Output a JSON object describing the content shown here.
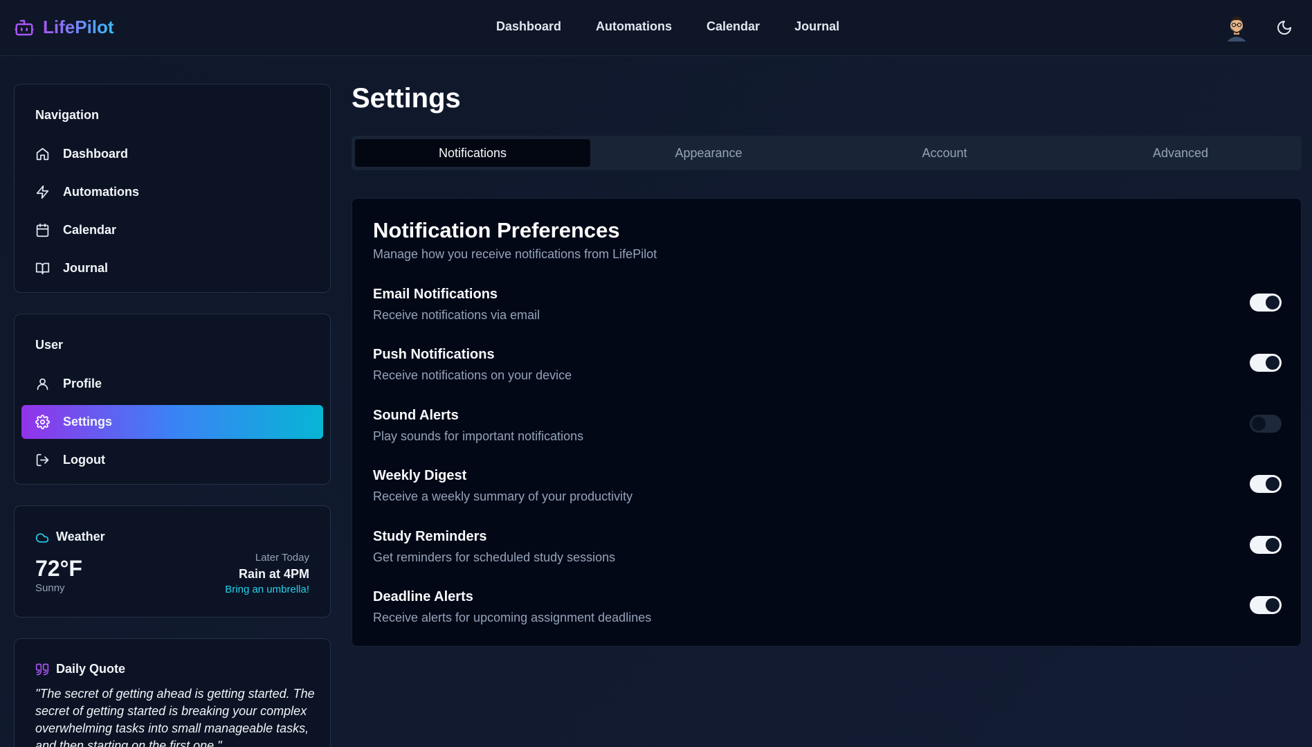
{
  "app": {
    "name": "LifePilot"
  },
  "topnav": {
    "items": [
      "Dashboard",
      "Automations",
      "Calendar",
      "Journal"
    ]
  },
  "sidebar": {
    "navigation": {
      "title": "Navigation",
      "items": [
        {
          "label": "Dashboard",
          "icon": "home-icon"
        },
        {
          "label": "Automations",
          "icon": "zap-icon"
        },
        {
          "label": "Calendar",
          "icon": "calendar-icon"
        },
        {
          "label": "Journal",
          "icon": "book-open-icon"
        }
      ]
    },
    "user": {
      "title": "User",
      "items": [
        {
          "label": "Profile",
          "icon": "user-icon"
        },
        {
          "label": "Settings",
          "icon": "gear-icon",
          "active": true
        },
        {
          "label": "Logout",
          "icon": "logout-icon"
        }
      ]
    },
    "weather": {
      "title": "Weather",
      "temperature": "72°F",
      "condition": "Sunny",
      "later_label": "Later Today",
      "forecast": "Rain at 4PM",
      "advice": "Bring an umbrella!"
    },
    "quote": {
      "title": "Daily Quote",
      "text": "\"The secret of getting ahead is getting started. The secret of getting started is breaking your complex overwhelming tasks into small manageable tasks, and then starting on the first one.\""
    }
  },
  "main": {
    "title": "Settings",
    "tabs": [
      {
        "label": "Notifications",
        "active": true
      },
      {
        "label": "Appearance"
      },
      {
        "label": "Account"
      },
      {
        "label": "Advanced"
      }
    ],
    "preferences": {
      "title": "Notification Preferences",
      "subtitle": "Manage how you receive notifications from LifePilot",
      "items": [
        {
          "label": "Email Notifications",
          "description": "Receive notifications via email",
          "enabled": true
        },
        {
          "label": "Push Notifications",
          "description": "Receive notifications on your device",
          "enabled": true
        },
        {
          "label": "Sound Alerts",
          "description": "Play sounds for important notifications",
          "enabled": false
        },
        {
          "label": "Weekly Digest",
          "description": "Receive a weekly summary of your productivity",
          "enabled": true
        },
        {
          "label": "Study Reminders",
          "description": "Get reminders for scheduled study sessions",
          "enabled": true
        },
        {
          "label": "Deadline Alerts",
          "description": "Receive alerts for upcoming assignment deadlines",
          "enabled": true
        }
      ]
    }
  },
  "colors": {
    "accent_start": "#9333ea",
    "accent_end": "#06b6d4",
    "background": "#0f172a",
    "info": "#22d3ee"
  }
}
